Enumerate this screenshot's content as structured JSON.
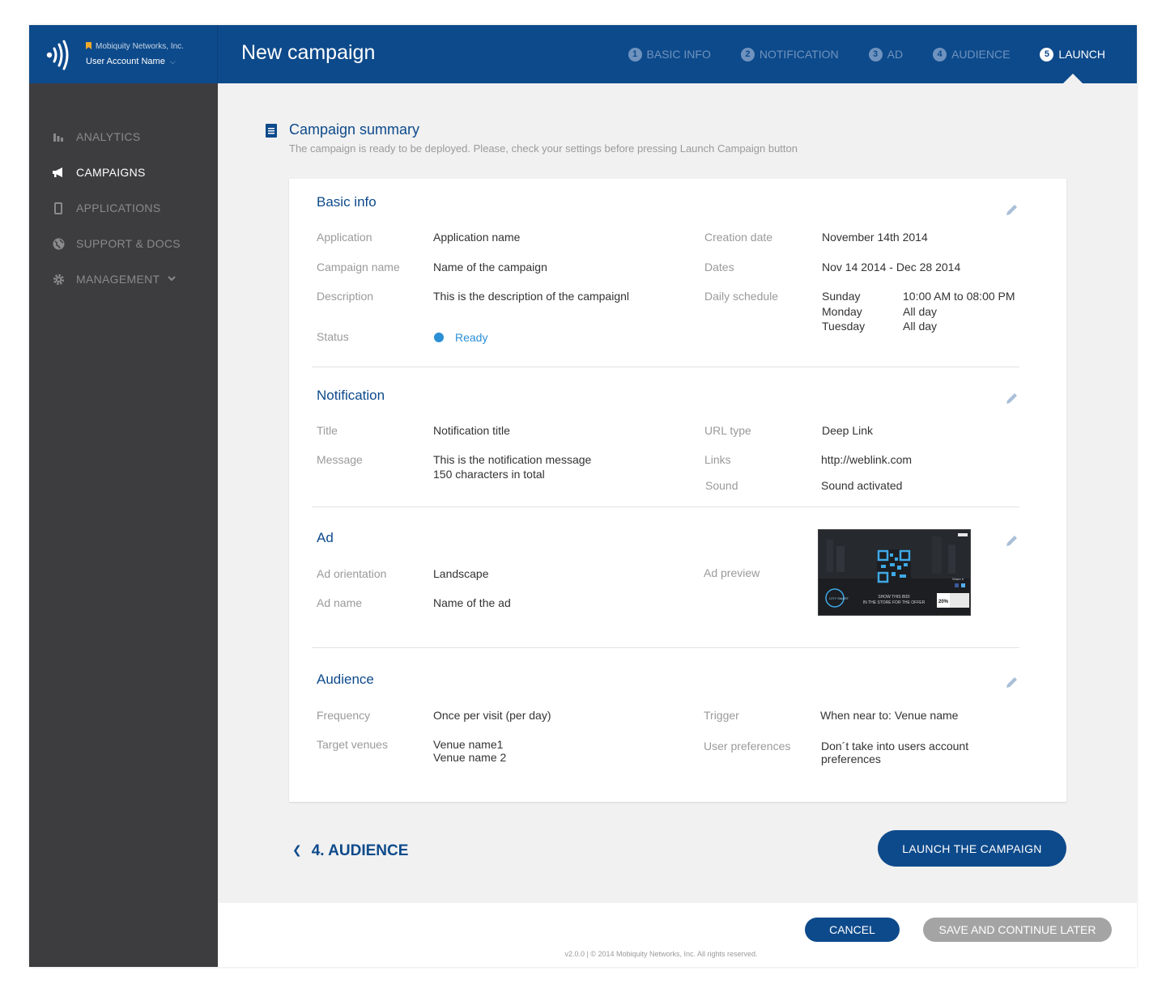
{
  "brand": {
    "org_name": "Mobiquity Networks, Inc.",
    "account_name": "User Account Name",
    "logo_icon": "mobiquity-logo-icon",
    "color": "#0d4a8b"
  },
  "sidebar": {
    "items": [
      {
        "label": "ANALYTICS",
        "icon": "bar-chart-icon"
      },
      {
        "label": "CAMPAIGNS",
        "icon": "megaphone-icon",
        "active": true
      },
      {
        "label": "APPLICATIONS",
        "icon": "phone-icon"
      },
      {
        "label": "SUPPORT & DOCS",
        "icon": "globe-icon"
      },
      {
        "label": "MANAGEMENT",
        "icon": "gear-icon"
      }
    ]
  },
  "header": {
    "title": "New campaign",
    "steps": [
      {
        "num": "1",
        "label": "BASIC INFO"
      },
      {
        "num": "2",
        "label": "NOTIFICATION"
      },
      {
        "num": "3",
        "label": "AD"
      },
      {
        "num": "4",
        "label": "AUDIENCE"
      },
      {
        "num": "5",
        "label": "LAUNCH",
        "active": true
      }
    ]
  },
  "summary": {
    "title": "Campaign summary",
    "subtitle": "The campaign is ready to be deployed. Please, check your settings before pressing Launch Campaign button"
  },
  "basic_info": {
    "title": "Basic info",
    "application_label": "Application",
    "application_value": "Application name",
    "campaign_name_label": "Campaign name",
    "campaign_name_value": "Name of the campaign",
    "description_label": "Description",
    "description_value": "This is the description of the campaignl",
    "status_label": "Status",
    "status_value": "Ready",
    "creation_date_label": "Creation date",
    "creation_date_value": "November 14th 2014",
    "dates_label": "Dates",
    "dates_value": "Nov 14 2014 - Dec 28 2014",
    "schedule_label": "Daily schedule",
    "schedule": [
      {
        "day": "Sunday",
        "time": "10:00 AM to 08:00 PM"
      },
      {
        "day": "Monday",
        "time": "All day"
      },
      {
        "day": "Tuesday",
        "time": "All day"
      }
    ]
  },
  "notification": {
    "title": "Notification",
    "title_label": "Title",
    "title_value": "Notification title",
    "message_label": "Message",
    "message_line1": "This is the notification message",
    "message_line2": "150 characters in total",
    "url_type_label": "URL type",
    "url_type_value": "Deep Link",
    "links_label": "Links",
    "links_value": "http://weblink.com",
    "sound_label": "Sound",
    "sound_value": "Sound activated"
  },
  "ad": {
    "title": "Ad",
    "orientation_label": "Ad orientation",
    "orientation_value": "Landscape",
    "name_label": "Ad name",
    "name_value": "Name of the ad",
    "preview_label": "Ad preview",
    "preview_line1": "SHOW THIS BIDI",
    "preview_line2": "IN THE STORE FOR THE OFFER",
    "preview_share": "Share it",
    "preview_badge": "20%",
    "preview_logo": "CITY SMART"
  },
  "audience": {
    "title": "Audience",
    "frequency_label": "Frequency",
    "frequency_value": "Once per visit  (per day)",
    "venues_label": "Target venues",
    "venue1": "Venue name1",
    "venue2": "Venue name 2",
    "trigger_label": "Trigger",
    "trigger_value": "When near to: Venue name",
    "prefs_label": "User preferences",
    "prefs_line1": "Don´t take into users account",
    "prefs_line2": "preferences"
  },
  "actions": {
    "back_label": "4. AUDIENCE",
    "launch_label": "LAUNCH THE CAMPAIGN",
    "cancel_label": "CANCEL",
    "save_label": "SAVE AND CONTINUE LATER"
  },
  "footer": {
    "copyright": "v2.0.0  |  © 2014 Mobiquity Networks, Inc. All rights reserved."
  },
  "colors": {
    "primary": "#0d4a8b",
    "sidebar_bg": "#3d3d3f",
    "status_blue": "#2b8fd6",
    "muted_button": "#a4a4a4"
  }
}
